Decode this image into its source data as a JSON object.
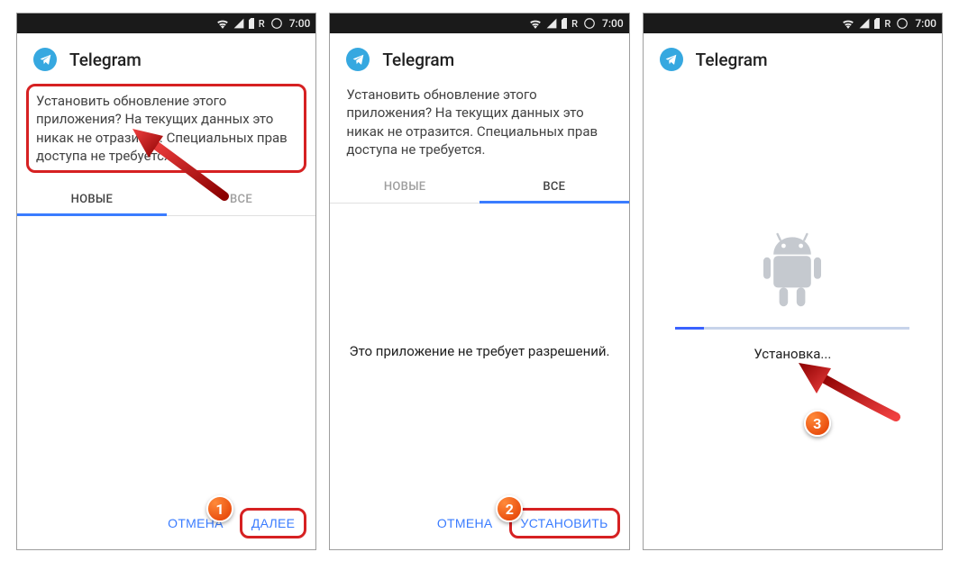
{
  "status": {
    "r_label": "R",
    "time": "7:00"
  },
  "app": {
    "title": "Telegram"
  },
  "screen1": {
    "message": "Установить обновление этого приложения? На текущих данных это никак не отразится. Специальных прав доступа не требуется.",
    "tabs": {
      "new": "НОВЫЕ",
      "all": "ВСЕ"
    },
    "cancel": "ОТМЕНА",
    "next": "ДАЛЕЕ",
    "step": "1"
  },
  "screen2": {
    "message": "Установить обновление этого приложения? На текущих данных это никак не отразится. Специальных прав доступа не требуется.",
    "tabs": {
      "new": "НОВЫЕ",
      "all": "ВСЕ"
    },
    "no_perms": "Это приложение не требует разрешений.",
    "cancel": "ОТМЕНА",
    "install": "УСТАНОВИТЬ",
    "step": "2"
  },
  "screen3": {
    "installing": "Установка...",
    "progress_pct": 12,
    "step": "3"
  }
}
